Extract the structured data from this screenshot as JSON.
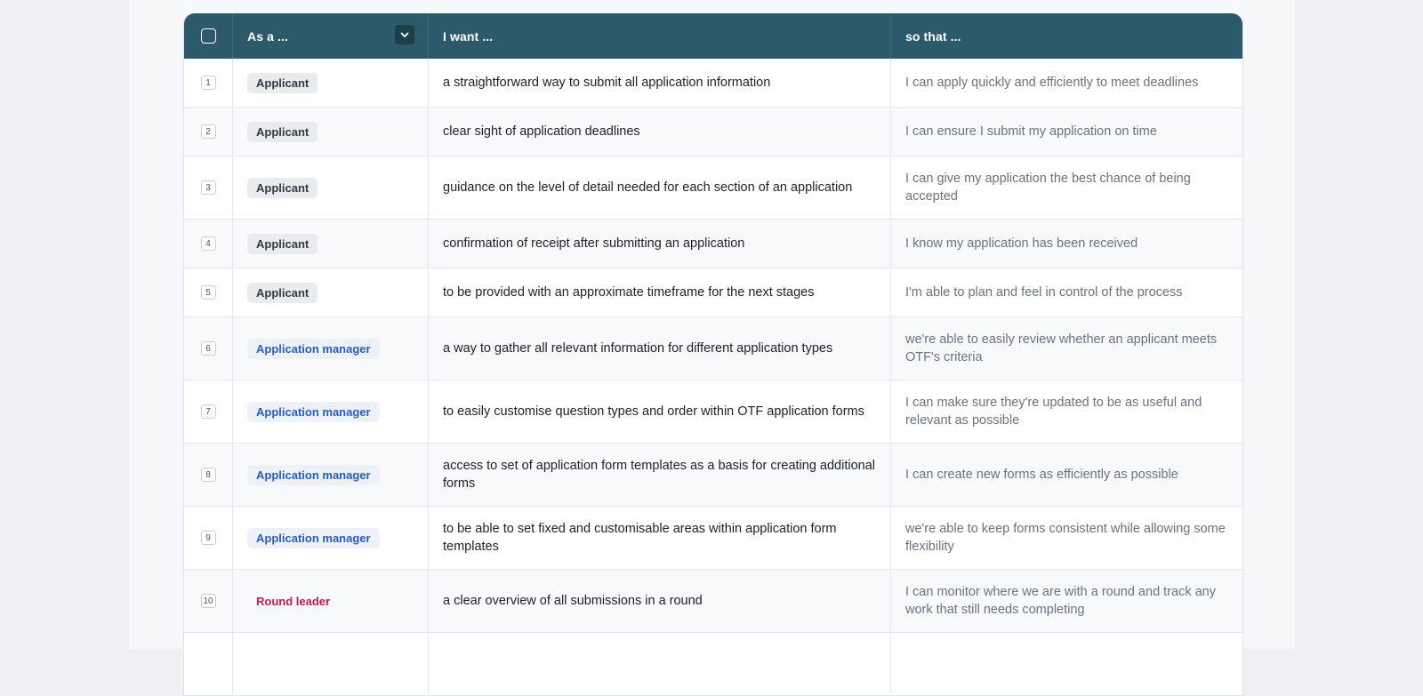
{
  "header": {
    "role_label": "As a ...",
    "want_label": "I want ...",
    "so_label": "so that ..."
  },
  "rows": [
    {
      "num": "1",
      "role": "Applicant",
      "want": "a straightforward way to submit all application information",
      "so": "I can apply quickly and efficiently to meet deadlines"
    },
    {
      "num": "2",
      "role": "Applicant",
      "want": "clear sight of application deadlines",
      "so": "I can ensure I submit my application on time"
    },
    {
      "num": "3",
      "role": "Applicant",
      "want": "guidance on the level of detail needed for each section of an application",
      "so": "I can give my application the best chance of being accepted"
    },
    {
      "num": "4",
      "role": "Applicant",
      "want": "confirmation of receipt after submitting an application",
      "so": "I know my application has been received"
    },
    {
      "num": "5",
      "role": "Applicant",
      "want": "to be provided with an approximate timeframe for the next stages",
      "so": "I'm able to plan and feel in control of the process"
    },
    {
      "num": "6",
      "role": "Application manager",
      "want": "a way to gather all relevant information for different application types",
      "so": "we're able to easily review whether an applicant meets OTF's criteria"
    },
    {
      "num": "7",
      "role": "Application manager",
      "want": "to easily customise question types and order within OTF application forms",
      "so": "I can make sure they're updated to be as useful and relevant as possible"
    },
    {
      "num": "8",
      "role": "Application manager",
      "want": "access to set of application form templates as a basis for creating additional forms",
      "so": "I can create new forms as efficiently as possible"
    },
    {
      "num": "9",
      "role": "Application manager",
      "want": "to be able to set fixed and customisable areas within application form templates",
      "so": "we're able to keep forms consistent while allowing some flexibility"
    },
    {
      "num": "10",
      "role": "Round leader",
      "want": "a clear overview of all submissions in a round",
      "so": "I can monitor where we are with a round and track any work that still needs completing"
    }
  ],
  "colors": {
    "header_bg": "#2d5a6b",
    "applicant_tag": "#333a45",
    "manager_tag": "#2a5bc2",
    "leader_tag": "#c2185b"
  }
}
